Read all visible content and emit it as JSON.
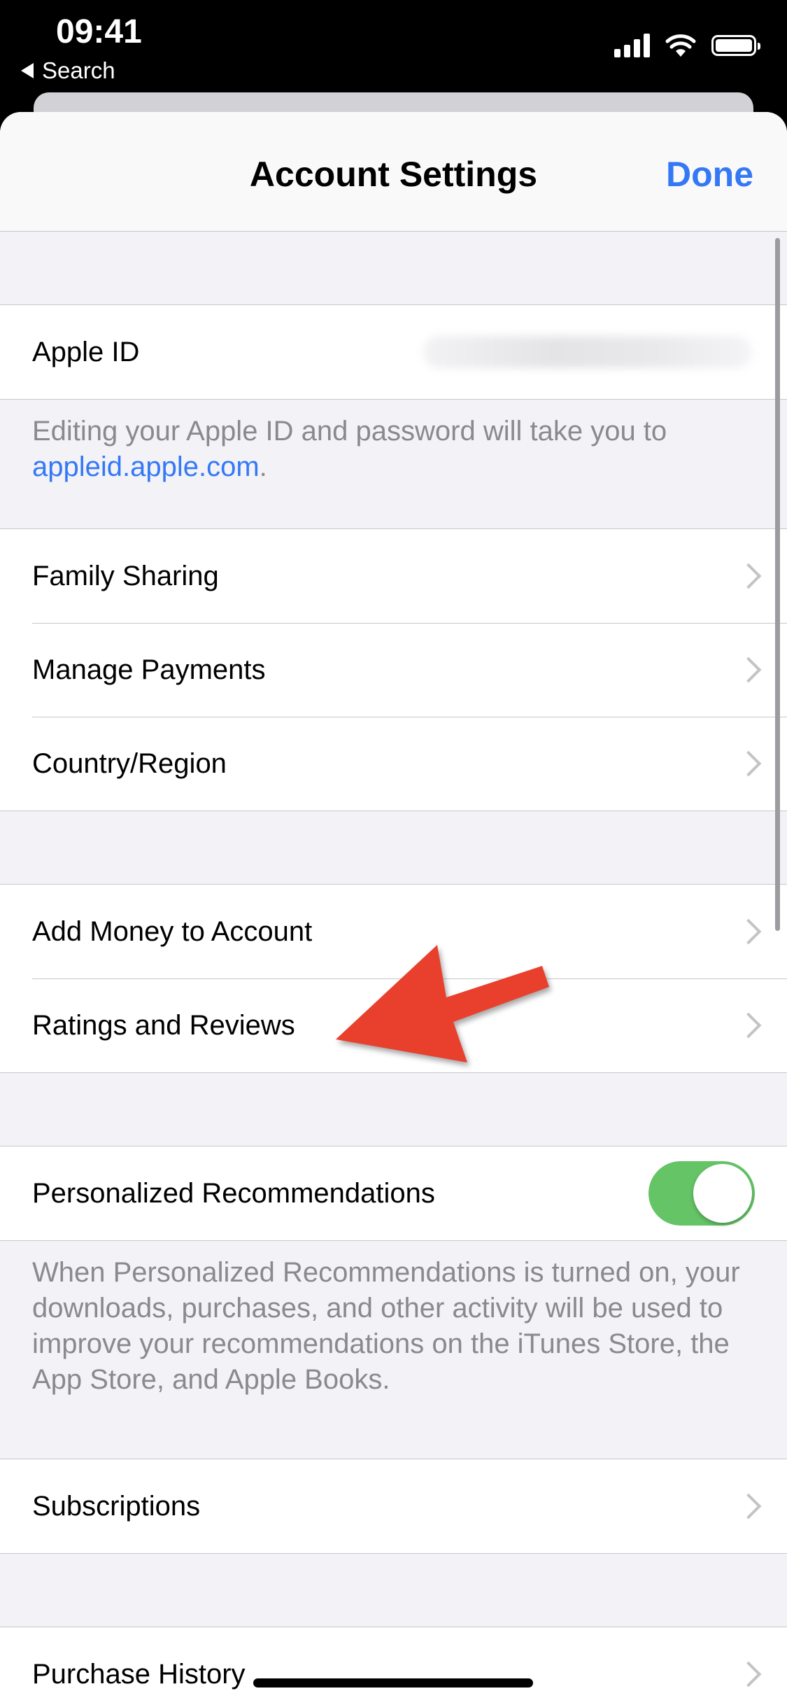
{
  "status_bar": {
    "time": "09:41",
    "back_label": "Search"
  },
  "nav": {
    "title": "Account Settings",
    "done": "Done"
  },
  "apple_id": {
    "label": "Apple ID",
    "footer_text": "Editing your Apple ID and password will take you to ",
    "footer_link": "appleid.apple.com",
    "footer_end": "."
  },
  "group_account": [
    "Family Sharing",
    "Manage Payments",
    "Country/Region"
  ],
  "group_money": [
    "Add Money to Account",
    "Ratings and Reviews"
  ],
  "personalized": {
    "label": "Personalized Recommendations",
    "enabled": true,
    "footer": "When Personalized Recommendations is turned on, your downloads, purchases, and other activity will be used to improve your recommendations on the iTunes Store, the App Store, and Apple Books."
  },
  "subscriptions": "Subscriptions",
  "purchase_history": "Purchase History",
  "colors": {
    "accent": "#3478f6",
    "toggle_on": "#65c466",
    "annotation_arrow": "#e8402d"
  },
  "icons": [
    "chevron-right-icon",
    "back-triangle-icon",
    "signal-icon",
    "wifi-icon",
    "battery-icon"
  ]
}
